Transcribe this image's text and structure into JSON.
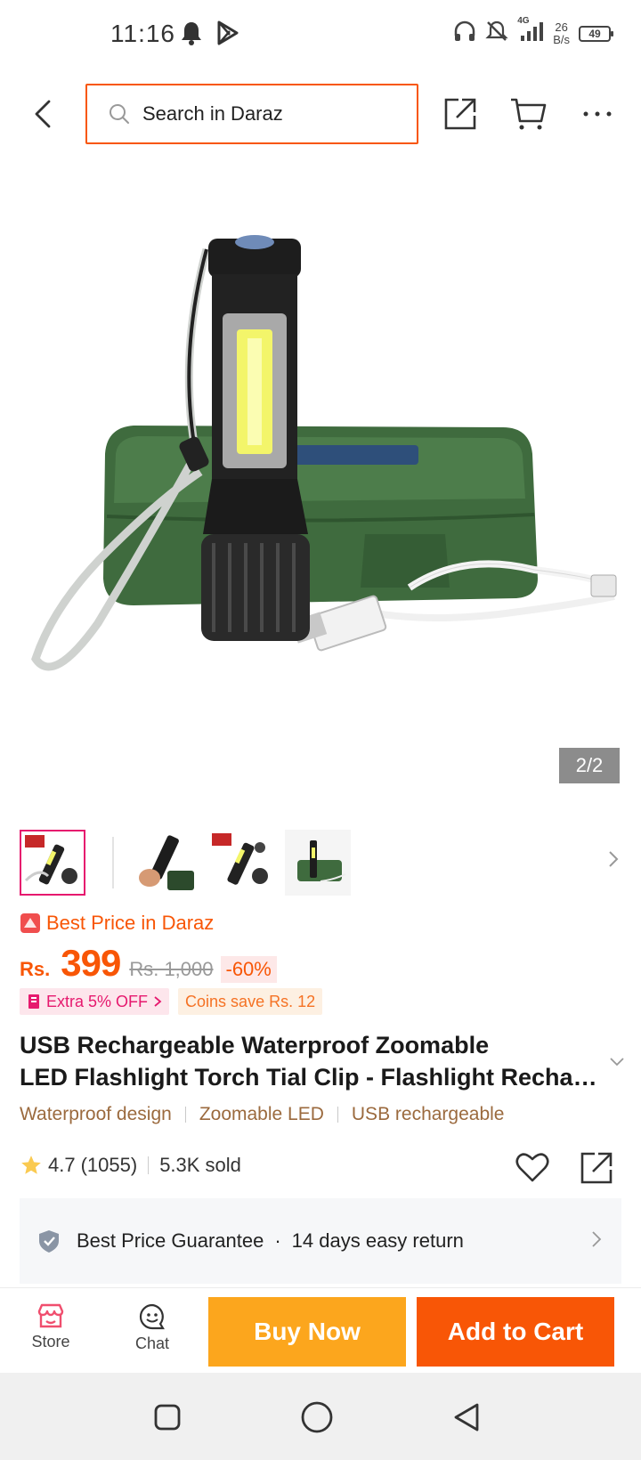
{
  "status_bar": {
    "time": "11:16",
    "network": "4G",
    "speed_value": "26",
    "speed_unit": "B/s",
    "battery": "49",
    "icons": [
      "bell-icon",
      "play-store-icon",
      "headphones-icon",
      "mute-icon",
      "signal-icon"
    ]
  },
  "header": {
    "search_placeholder": "Search in Daraz",
    "icons": [
      "back-icon",
      "search-icon",
      "share-icon",
      "cart-icon",
      "more-icon"
    ]
  },
  "gallery": {
    "counter": "2/2",
    "image": "flashlight-with-green-case-and-usb-cable"
  },
  "product": {
    "best_price_label": "Best Price in Daraz",
    "currency": "Rs.",
    "price": "399",
    "original_price": "Rs. 1,000",
    "discount": "-60%",
    "promo_extra": "Extra 5% OFF",
    "promo_coins": "Coins save Rs. 12",
    "title_line1": "USB Rechargeable Waterproof Zoomable",
    "title_line2": "LED Flashlight Torch Tial Clip - Flashlight Rechargeable",
    "features": [
      "Waterproof design",
      "Zoomable LED",
      "USB rechargeable"
    ],
    "rating": "4.7",
    "reviews": "(1055)",
    "sold": "5.3K sold"
  },
  "guarantee": {
    "text1": "Best Price Guarantee",
    "separator": "·",
    "text2": "14 days easy return"
  },
  "action_bar": {
    "store_label": "Store",
    "chat_label": "Chat",
    "buy_now": "Buy Now",
    "add_to_cart": "Add to Cart"
  },
  "colors": {
    "brand_orange": "#f85606",
    "buy_now_yellow": "#fca61d",
    "promo_pink": "#e6196e",
    "feature_brown": "#9b6a3e"
  }
}
